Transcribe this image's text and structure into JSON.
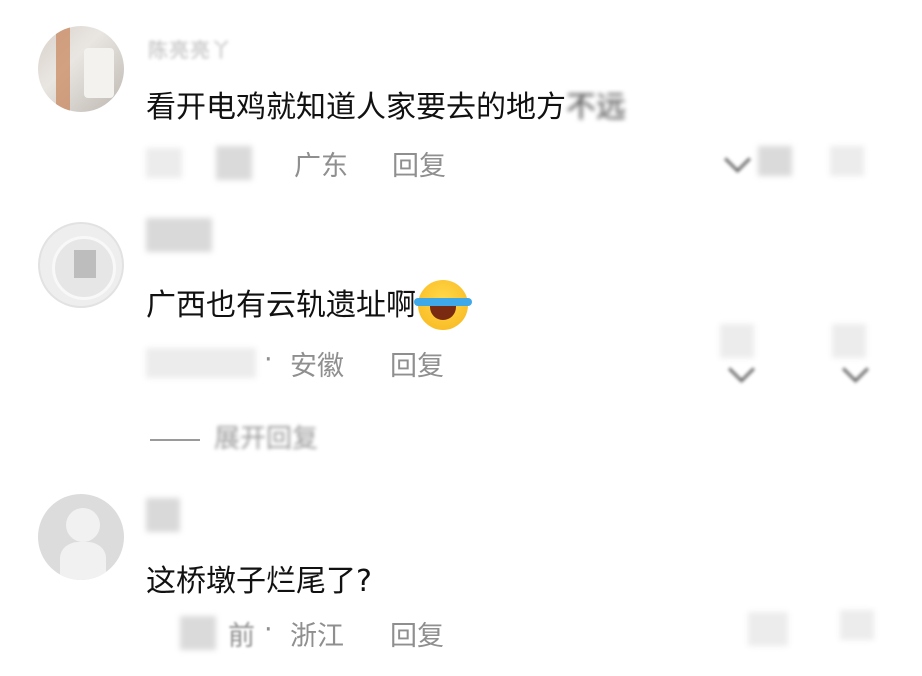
{
  "comments": [
    {
      "username": "陈亮亮丫",
      "text": "看开电鸡就知道人家要去的地方",
      "text_tail": "不远",
      "location": "广东",
      "reply_label": "回复"
    },
    {
      "username": "",
      "text": "广西也有云轨遗址啊",
      "emoji": "laughing-crying-emoji",
      "location": "安徽",
      "location_prefix": "·",
      "reply_label": "回复"
    },
    {
      "username": "",
      "text": "这桥墩子烂尾了?",
      "time_suffix": "前",
      "location_prefix": "·",
      "location": "浙江",
      "reply_label": "回复"
    }
  ],
  "collapsed_replies": {
    "label": "展开回复"
  },
  "icons": {
    "dislike": "chevron-down-icon",
    "like": "like-icon"
  },
  "colors": {
    "text": "#111111",
    "meta": "#8f8f8f",
    "background": "#ffffff"
  }
}
